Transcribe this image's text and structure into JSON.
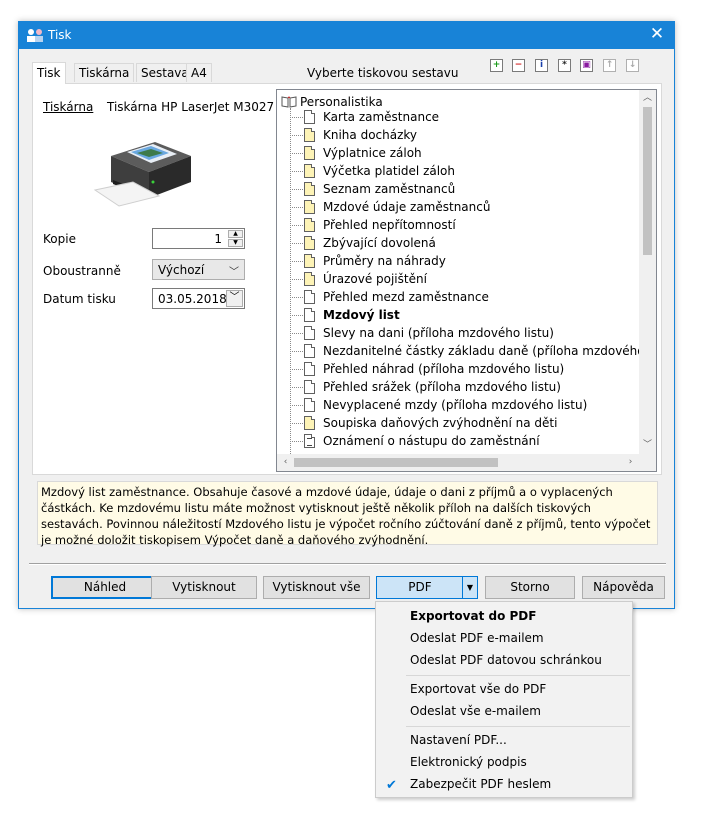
{
  "window": {
    "title": "Tisk",
    "close_glyph": "✕"
  },
  "tabs": [
    {
      "label": "Tisk",
      "active": true
    },
    {
      "label": "Tiskárna",
      "active": false
    },
    {
      "label": "Sestava",
      "active": false
    },
    {
      "label": "A4",
      "active": false
    }
  ],
  "section_title": "Vyberte tiskovou sestavu",
  "toolbar_icons": [
    "add-icon",
    "remove-icon",
    "info-icon",
    "asterisk-icon",
    "copy-icon",
    "move-up-icon",
    "move-down-icon"
  ],
  "printer": {
    "label": "Tiskárna",
    "name": "Tiskárna HP LaserJet M3027"
  },
  "copies": {
    "label": "Kopie",
    "value": "1"
  },
  "duplex": {
    "label": "Oboustranně",
    "value": "Výchozí"
  },
  "print_date": {
    "label": "Datum tisku",
    "value": "03.05.2018"
  },
  "tree": {
    "root": "Personalistika",
    "items": [
      {
        "label": "Karta zaměstnance",
        "icon": "white"
      },
      {
        "label": "Kniha docházky",
        "icon": "yellow"
      },
      {
        "label": "Výplatnice záloh",
        "icon": "yellow"
      },
      {
        "label": "Výčetka platidel záloh",
        "icon": "yellow"
      },
      {
        "label": "Seznam zaměstnanců",
        "icon": "yellow"
      },
      {
        "label": "Mzdové údaje zaměstnanců",
        "icon": "yellow"
      },
      {
        "label": "Přehled nepřítomností",
        "icon": "yellow"
      },
      {
        "label": "Zbývající dovolená",
        "icon": "yellow"
      },
      {
        "label": "Průměry na náhrady",
        "icon": "yellow"
      },
      {
        "label": "Úrazové pojištění",
        "icon": "yellow"
      },
      {
        "label": "Přehled mezd zaměstnance",
        "icon": "white"
      },
      {
        "label": "Mzdový list",
        "icon": "white",
        "bold": true
      },
      {
        "label": "Slevy na dani (příloha mzdového listu)",
        "icon": "white"
      },
      {
        "label": "Nezdanitelné částky základu daně (příloha mzdového listu)",
        "icon": "white"
      },
      {
        "label": "Přehled náhrad (příloha mzdového listu)",
        "icon": "white"
      },
      {
        "label": "Přehled srážek (příloha mzdového listu)",
        "icon": "white"
      },
      {
        "label": "Nevyplacené mzdy (příloha mzdového listu)",
        "icon": "white"
      },
      {
        "label": "Soupiska daňových zvýhodnění na děti",
        "icon": "yellow"
      },
      {
        "label": "Oznámení o nástupu do zaměstnání",
        "icon": "lined"
      }
    ]
  },
  "description": "Mzdový list zaměstnance. Obsahuje časové a mzdové údaje, údaje o dani z příjmů a o vyplacených částkách. Ke mzdovému listu máte možnost vytisknout ještě několik příloh na dalších tiskových sestavách. Povinnou náležitostí Mzdového listu je výpočet ročního zúčtování daně z příjmů, tento výpočet je možné doložit tiskopisem Výpočet daně a daňového zvýhodnění.",
  "buttons": {
    "preview": "Náhled",
    "print": "Vytisknout",
    "print_all": "Vytisknout vše",
    "pdf": "PDF",
    "cancel": "Storno",
    "help": "Nápověda"
  },
  "pdf_menu": {
    "export_pdf": "Exportovat do PDF",
    "send_email": "Odeslat PDF e-mailem",
    "send_databox": "Odeslat PDF datovou schránkou",
    "export_all": "Exportovat vše do PDF",
    "send_all_email": "Odeslat vše e-mailem",
    "settings": "Nastavení PDF...",
    "signature": "Elektronický podpis",
    "secure": "Zabezpečit PDF heslem",
    "secure_checked": true
  },
  "colors": {
    "accent": "#1883d7",
    "doc_yellow": "#fdf3b6",
    "desc_bg": "#fffbe6"
  }
}
